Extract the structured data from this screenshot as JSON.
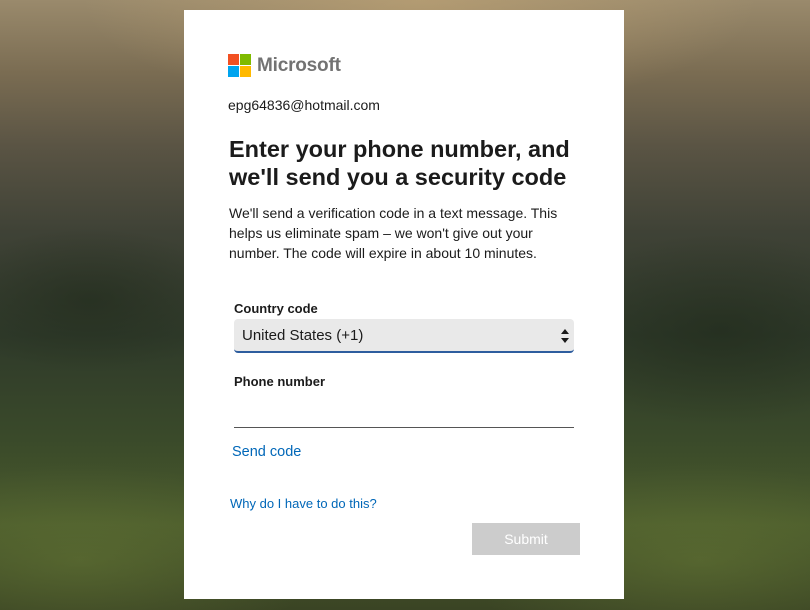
{
  "logo": {
    "text": "Microsoft",
    "colors": [
      "#f25022",
      "#7fba00",
      "#00a4ef",
      "#ffb900"
    ]
  },
  "account": {
    "email": "epg64836@hotmail.com"
  },
  "heading": "Enter your phone number, and we'll send you a security code",
  "description": "We'll send a verification code in a text message. This helps us eliminate spam – we won't give out your number. The code will expire in about 10 minutes.",
  "country_code": {
    "label": "Country code",
    "selected": "United States (+1)"
  },
  "phone": {
    "label": "Phone number",
    "value": ""
  },
  "links": {
    "send_code": "Send code",
    "why": "Why do I have to do this?"
  },
  "buttons": {
    "submit": "Submit"
  },
  "colors": {
    "link": "#0067b8",
    "submit_disabled": "#cccccc",
    "select_underline": "#2e5d9e"
  }
}
